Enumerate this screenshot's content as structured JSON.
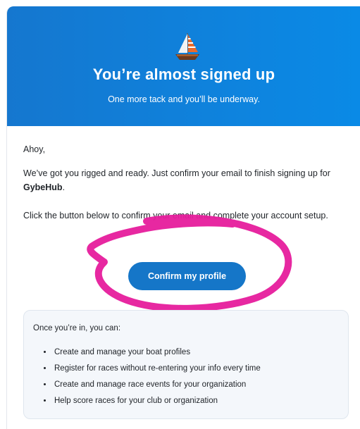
{
  "header": {
    "icon": "sailboat-icon",
    "title": "You’re almost signed up",
    "subtitle": "One more tack and you’ll be underway.",
    "gradient_start": "#1577cf",
    "gradient_end": "#0a8ae6"
  },
  "body": {
    "greeting": "Ahoy,",
    "paragraph1_text": "We’ve got you rigged and ready. Just confirm your email to finish signing up for ",
    "brand_name": "GybeHub",
    "paragraph1_end": ".",
    "paragraph2": "Click the button below to confirm your email and complete your account setup."
  },
  "cta": {
    "label": "Confirm my profile",
    "color": "#1576c8"
  },
  "annotation": {
    "color": "#e61c9c",
    "icon": "freehand-circle-scribble"
  },
  "info": {
    "intro": "Once you’re in, you can:",
    "items": [
      "Create and manage your boat profiles",
      "Register for races without re-entering your info every time",
      "Create and manage race events for your organization",
      "Help score races for your club or organization"
    ]
  }
}
